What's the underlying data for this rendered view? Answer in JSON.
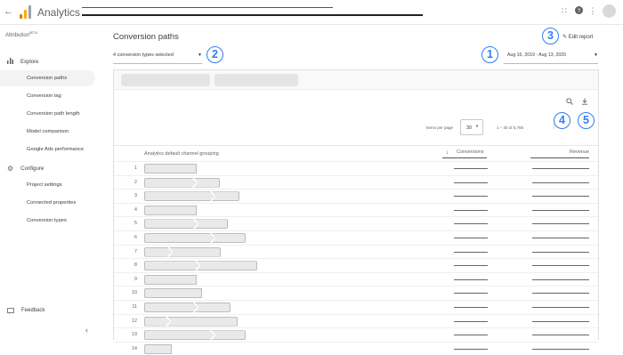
{
  "topbar": {
    "back_icon": "arrow-left-icon",
    "logo_icon": "analytics-logo-icon",
    "title": "Analytics",
    "apps_icon": "apps-grid-icon",
    "help_icon": "help-icon",
    "more_icon": "more-vert-icon"
  },
  "sidebar": {
    "section_label": "Attribution",
    "section_badge": "BETA",
    "explore": {
      "label": "Explore",
      "icon": "bar-chart-icon"
    },
    "explore_items": [
      {
        "label": "Conversion paths",
        "active": true
      },
      {
        "label": "Conversion lag",
        "active": false
      },
      {
        "label": "Conversion path length",
        "active": false
      },
      {
        "label": "Model comparison",
        "active": false
      },
      {
        "label": "Google Ads performance",
        "active": false
      }
    ],
    "configure": {
      "label": "Configure",
      "icon": "gear-icon"
    },
    "configure_items": [
      {
        "label": "Project settings"
      },
      {
        "label": "Connected properties"
      },
      {
        "label": "Conversion types"
      }
    ],
    "feedback_label": "Feedback",
    "collapse_icon": "chevron-left-icon"
  },
  "main": {
    "title": "Conversion paths",
    "edit_report_label": "Edit report",
    "conversion_select_value": "4 conversion types selected",
    "date_range_value": "Aug 16, 2019 - Aug 13, 2020"
  },
  "annotations": [
    "1",
    "2",
    "3",
    "4",
    "5"
  ],
  "table": {
    "search_icon": "search-icon",
    "download_icon": "download-icon",
    "items_per_page_label": "Items per page",
    "items_per_page_value": "30",
    "range_text": "1 – 30 of 6,765",
    "columns": {
      "grouping": "Analytics default channel grouping",
      "conversions": "Conversions",
      "revenue": "Revenue"
    },
    "sort_icon": "arrow-down-icon",
    "rows": [
      "1",
      "2",
      "3",
      "4",
      "5",
      "6",
      "7",
      "8",
      "9",
      "10",
      "11",
      "12",
      "13",
      "14"
    ]
  },
  "colors": {
    "accent": "#2d7ff0",
    "active_bg": "#f1f3f4"
  }
}
